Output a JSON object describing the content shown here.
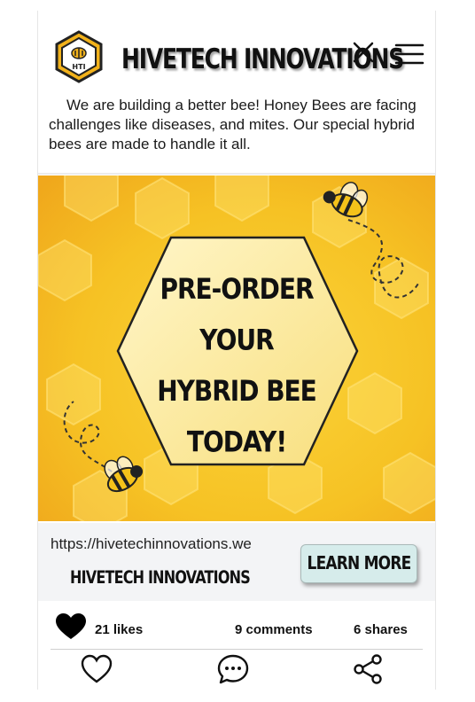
{
  "header": {
    "brand": "HIVETECH INNOVATIONS",
    "logo_text": "HTI"
  },
  "description": "We are building a better bee! Honey Bees are facing challenges like diseases, and mites. Our special hybrid bees are made to handle it all.",
  "promo": {
    "lines": [
      "PRE-ORDER",
      "YOUR",
      "HYBRID BEE",
      "TODAY!"
    ]
  },
  "link": {
    "url": "https://hivetechinnovations.we",
    "brand": "HIVETECH INNOVATIONS",
    "button_label": "LEARN MORE"
  },
  "stats": {
    "likes": "21 likes",
    "comments": "9 comments",
    "shares": "6 shares"
  },
  "icons": {
    "close": "close-icon",
    "menu": "menu-icon",
    "likes": "heart-filled-icon",
    "like": "heart-outline-icon",
    "comment": "comment-icon",
    "share": "share-icon"
  },
  "colors": {
    "accent_yellow": "#f5c21a",
    "honey_orange": "#f0a81c",
    "button_bg": "#d6eceb"
  }
}
